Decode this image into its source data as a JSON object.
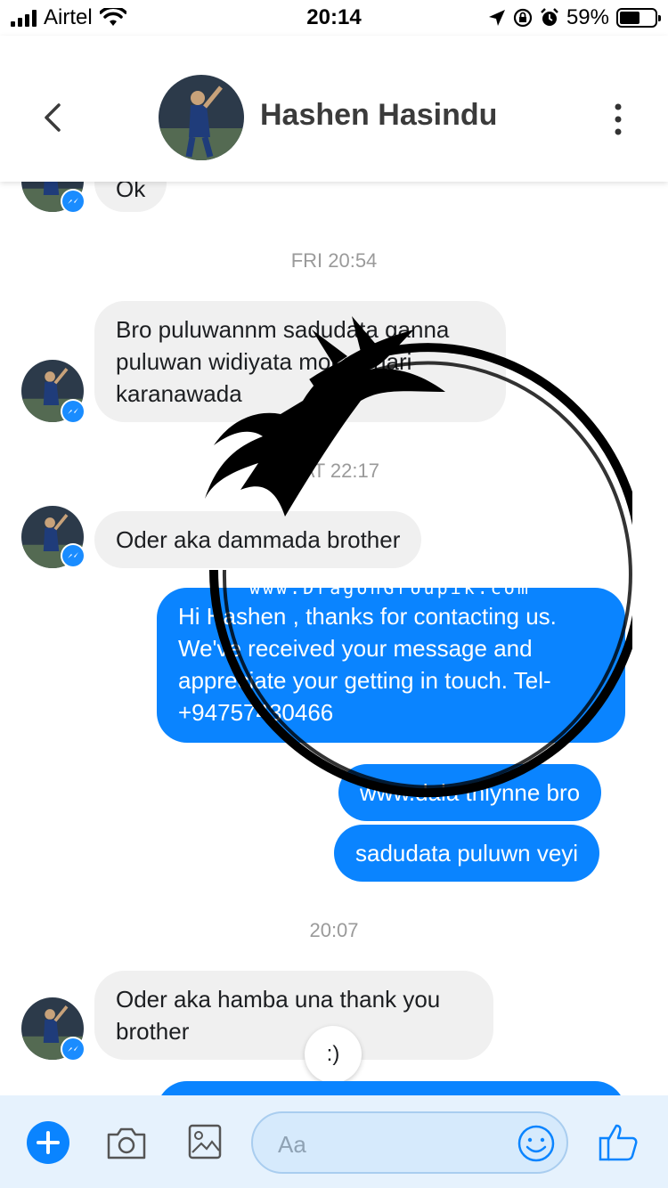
{
  "status_bar": {
    "carrier": "Airtel",
    "time": "20:14",
    "battery": "59%",
    "battery_level": 0.59
  },
  "header": {
    "contact_name": "Hashen Hasindu",
    "back_icon": "chevron-left-icon",
    "menu_icon": "vertical-dots-icon"
  },
  "messages": {
    "m0": "Ok",
    "ts1": "FRI 20:54",
    "m1": "Bro puluwannm sadudata ganna puluwan widiyata mokak hari karanawada",
    "ts2": "SAT 22:17",
    "m2": "Oder aka dammada brother",
    "m3": "Hi Hashen , thanks for contacting us. We've received your message and appreciate your getting in touch. Tel-+94757430466",
    "m4": "www.dala thiynne bro",
    "m5": "sadudata puluwn veyi",
    "ts3": "20:07",
    "m6": "Oder aka hamba una thank you brother",
    "reaction": ":)"
  },
  "watermark": {
    "text": "www.DragonGroupik.com"
  },
  "composer": {
    "placeholder": "Aa"
  },
  "colors": {
    "accent": "#0a84ff",
    "incoming_bubble": "#f0f0f0",
    "composer_bg": "#e6f2fd"
  }
}
